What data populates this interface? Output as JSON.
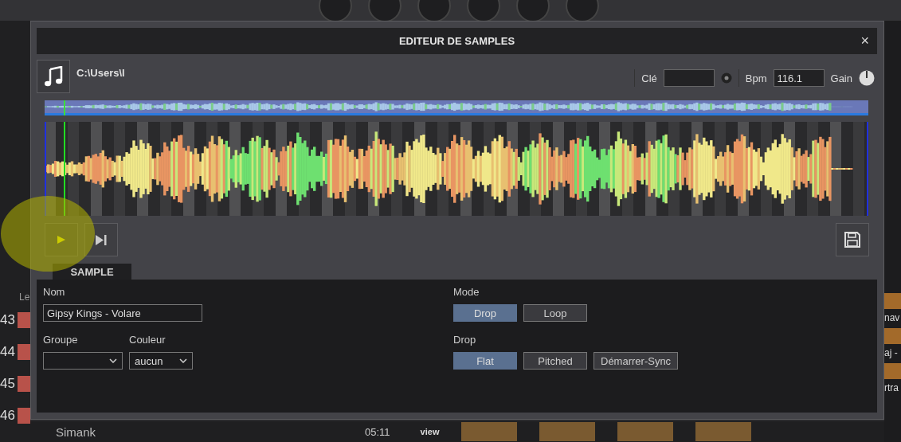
{
  "background": {
    "row_numbers": [
      "43",
      "44",
      "45",
      "46"
    ],
    "column_header": "Le",
    "right_texts": [
      "nav",
      "aj -",
      "rtra"
    ],
    "track_title": "Simank",
    "track_time": "05:11",
    "side_tab": "view"
  },
  "dialog": {
    "title": "EDITEUR DE SAMPLES",
    "close": "×",
    "path": "C:\\Users\\l",
    "key": {
      "label": "Clé"
    },
    "bpm": {
      "label": "Bpm",
      "value": "116.1"
    },
    "gain": {
      "label": "Gain"
    },
    "tabs": [
      {
        "label": "SAMPLE",
        "selected": true
      }
    ],
    "form": {
      "name": {
        "label": "Nom",
        "value": "Gipsy Kings - Volare"
      },
      "group": {
        "label": "Groupe"
      },
      "color": {
        "label": "Couleur",
        "value": "aucun"
      },
      "mode": {
        "label": "Mode",
        "options": [
          {
            "label": "Drop",
            "selected": true
          },
          {
            "label": "Loop",
            "selected": false
          }
        ]
      },
      "drop": {
        "label": "Drop",
        "options": [
          {
            "label": "Flat",
            "selected": true
          },
          {
            "label": "Pitched",
            "selected": false
          },
          {
            "label": "Démarrer-Sync",
            "selected": false
          }
        ]
      }
    }
  }
}
